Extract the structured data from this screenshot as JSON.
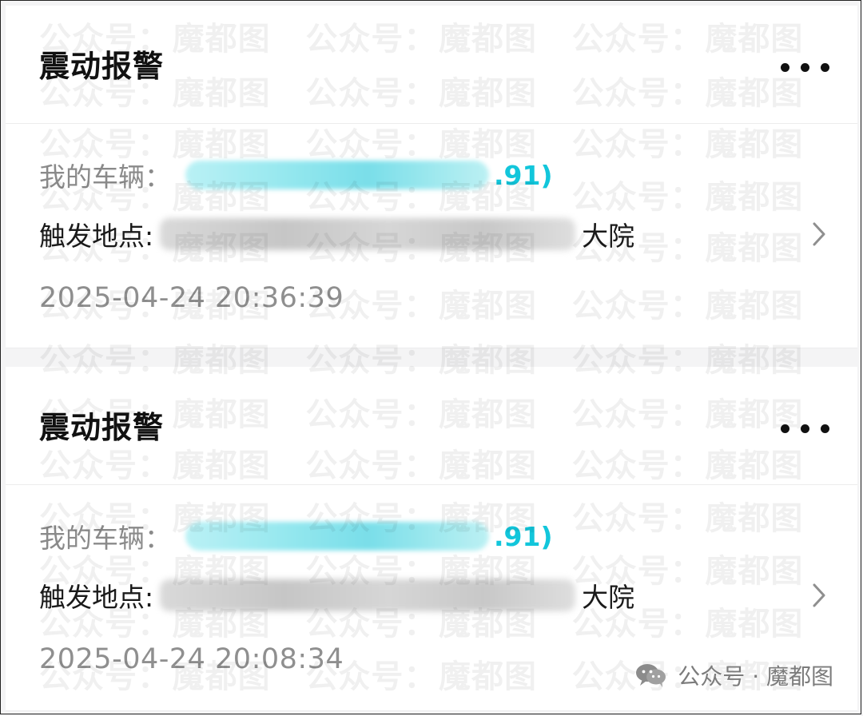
{
  "watermark": {
    "brand": "公众号：",
    "name": "魔都图"
  },
  "alerts": [
    {
      "title": "震动报警",
      "vehicle_label": "我的车辆：",
      "vehicle_suffix": ".91)",
      "location_label": "触发地点:",
      "location_suffix": "大院",
      "timestamp": "2025-04-24 20:36:39"
    },
    {
      "title": "震动报警",
      "vehicle_label": "我的车辆：",
      "vehicle_suffix": ".91)",
      "location_label": "触发地点:",
      "location_suffix": "大院",
      "timestamp": "2025-04-24 20:08:34"
    }
  ],
  "footer": {
    "source": "公众号 · 魔都图"
  },
  "colors": {
    "accent": "#12c6db",
    "text_primary": "#111111",
    "text_muted": "#8a8a8a",
    "background": "#f4f4f5",
    "card": "#ffffff"
  },
  "icons": {
    "more": "more-horizontal-icon",
    "chevron": "chevron-right-icon",
    "wechat": "wechat-icon"
  }
}
